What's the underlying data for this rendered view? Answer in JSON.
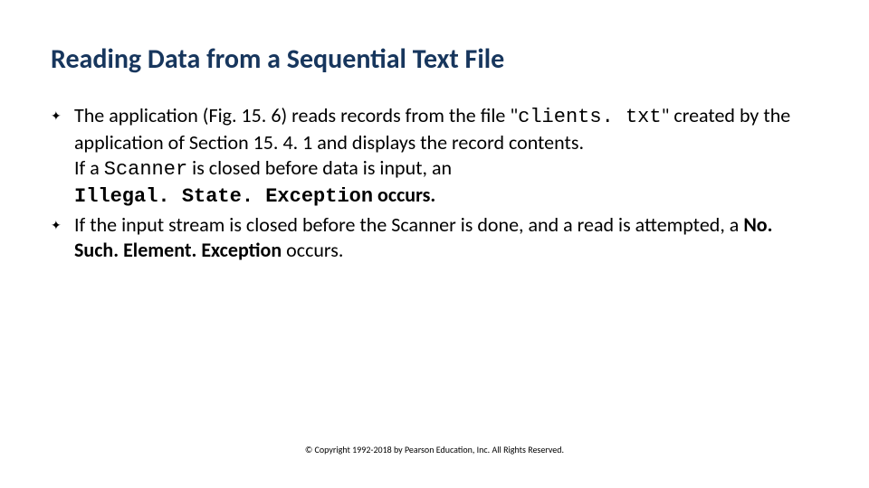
{
  "title": "Reading Data from a Sequential Text File",
  "bullets": [
    {
      "part1": "The application (Fig. 15. 6) reads records from the file \"",
      "code1": "clients. txt",
      "part2": "\" created by the application of Section 15. 4. 1 and displays the record contents.",
      "line2a": "If a ",
      "code2": "Scanner",
      "line2b": " is closed before data is input, an ",
      "code3": "Illegal. State. Exception",
      "line2c": " occurs."
    },
    {
      "part1": "If the input stream is closed before the Scanner is done, and a read is attempted, a ",
      "bold1": "No. Such. Element. Exception",
      "part2": " occurs."
    }
  ],
  "footer": "© Copyright 1992-2018 by Pearson Education, Inc. All Rights Reserved."
}
